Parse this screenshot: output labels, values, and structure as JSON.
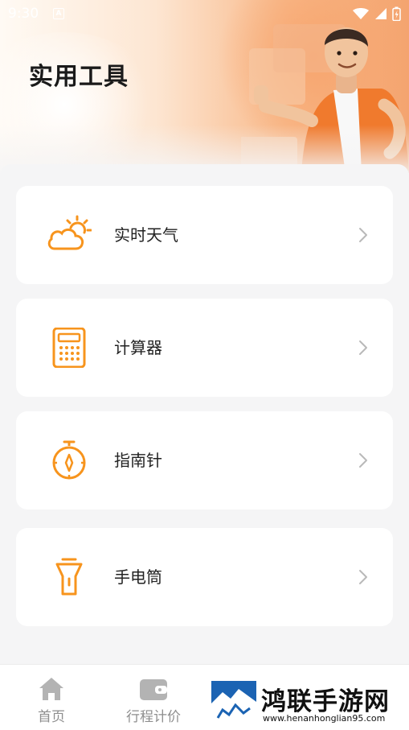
{
  "status_bar": {
    "time": "9:30",
    "notification_letter": "A"
  },
  "header": {
    "title": "实用工具"
  },
  "tools": [
    {
      "label": "实时天气",
      "icon": "weather-icon"
    },
    {
      "label": "计算器",
      "icon": "calculator-icon"
    },
    {
      "label": "指南针",
      "icon": "compass-icon"
    },
    {
      "label": "手电筒",
      "icon": "flashlight-icon"
    }
  ],
  "tabs": [
    {
      "label": "首页",
      "icon": "home-icon"
    },
    {
      "label": "行程计价",
      "icon": "wallet-icon"
    }
  ],
  "watermark": {
    "title": "鸿联手游网",
    "url": "www.henanhonglian95.com"
  },
  "colors": {
    "accent": "#f7941d",
    "hero": "#f4a46f",
    "text": "#222222",
    "tab_inactive": "#8e8e8e"
  }
}
